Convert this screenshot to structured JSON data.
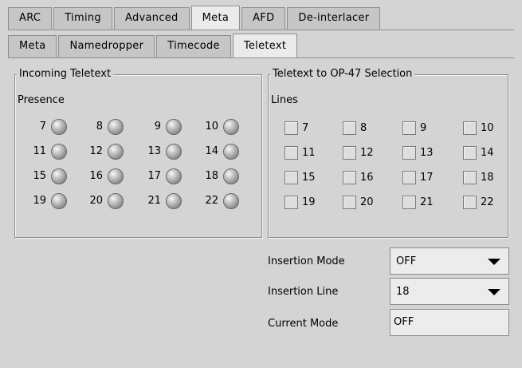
{
  "tabs": {
    "top": [
      {
        "label": "ARC",
        "active": false
      },
      {
        "label": "Timing",
        "active": false
      },
      {
        "label": "Advanced",
        "active": false
      },
      {
        "label": "Meta",
        "active": true
      },
      {
        "label": "AFD",
        "active": false
      },
      {
        "label": "De-interlacer",
        "active": false
      }
    ],
    "sub": [
      {
        "label": "Meta",
        "active": false
      },
      {
        "label": "Namedropper",
        "active": false
      },
      {
        "label": "Timecode",
        "active": false
      },
      {
        "label": "Teletext",
        "active": true
      }
    ]
  },
  "incoming": {
    "title": "Incoming Teletext",
    "presence_label": "Presence",
    "lines": [
      "7",
      "8",
      "9",
      "10",
      "11",
      "12",
      "13",
      "14",
      "15",
      "16",
      "17",
      "18",
      "19",
      "20",
      "21",
      "22"
    ]
  },
  "selection": {
    "title": "Teletext to OP-47 Selection",
    "lines_label": "Lines",
    "lines": [
      {
        "label": "7",
        "checked": false
      },
      {
        "label": "8",
        "checked": false
      },
      {
        "label": "9",
        "checked": false
      },
      {
        "label": "10",
        "checked": false
      },
      {
        "label": "11",
        "checked": false
      },
      {
        "label": "12",
        "checked": false
      },
      {
        "label": "13",
        "checked": false
      },
      {
        "label": "14",
        "checked": false
      },
      {
        "label": "15",
        "checked": false
      },
      {
        "label": "16",
        "checked": false
      },
      {
        "label": "17",
        "checked": false
      },
      {
        "label": "18",
        "checked": false
      },
      {
        "label": "19",
        "checked": false
      },
      {
        "label": "20",
        "checked": false
      },
      {
        "label": "21",
        "checked": false
      },
      {
        "label": "22",
        "checked": false
      }
    ]
  },
  "form": {
    "insertion_mode_label": "Insertion Mode",
    "insertion_mode_value": "OFF",
    "insertion_line_label": "Insertion Line",
    "insertion_line_value": "18",
    "current_mode_label": "Current Mode",
    "current_mode_value": "OFF"
  },
  "colors": {
    "background": "#d4d4d4",
    "active_tab": "#ebebeb",
    "tab": "#c6c6c6",
    "led_off": "#9a9a9a"
  }
}
